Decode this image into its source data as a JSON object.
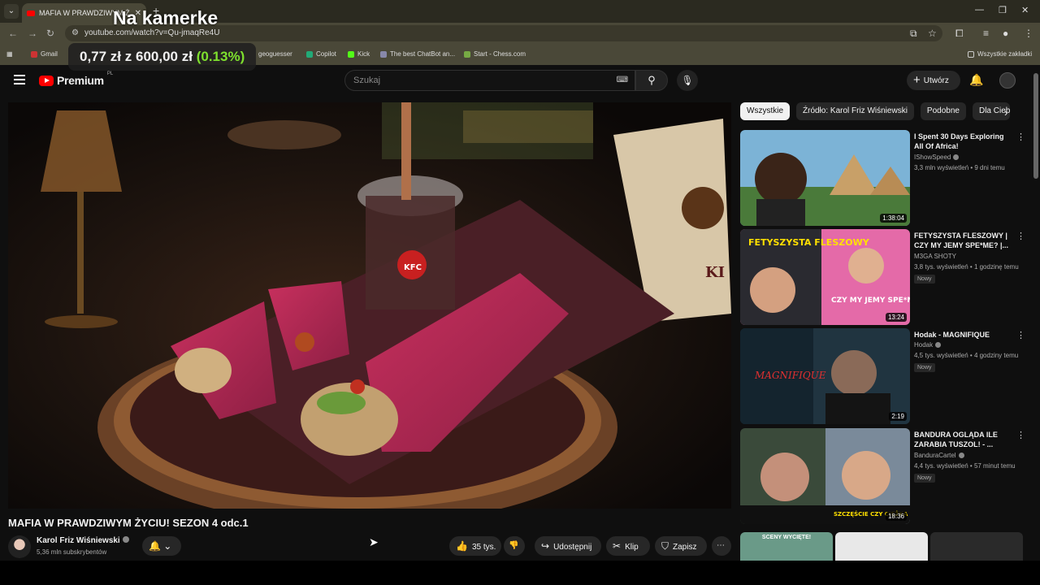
{
  "browser": {
    "tab_title": "MAFIA W PRAWDZIWYM Ż...",
    "url": "youtube.com/watch?v=Qu-jmaqRe4U",
    "bookmarks": [
      "Gmail",
      "geoguesser",
      "Copilot",
      "Kick",
      "The best ChatBot an...",
      "Start - Chess.com"
    ],
    "all_bookmarks": "Wszystkie zakładki"
  },
  "overlay": {
    "title": "Na kamerke",
    "price_current": "0,77 zł",
    "price_sep": "z",
    "price_total": "600,00 zł",
    "price_pct": "(0.13%)"
  },
  "header": {
    "logo": "Premium",
    "region": "PL",
    "search_placeholder": "Szukaj",
    "create_label": "Utwórz"
  },
  "video": {
    "title": "MAFIA W PRAWDZIWYM ŻYCIU! SEZON 4 odc.1",
    "channel": "Karol Friz Wiśniewski",
    "subscribers": "5,36 mln subskrybentów",
    "likes": "35 tys.",
    "share": "Udostępnij",
    "clip": "Klip",
    "save": "Zapisz"
  },
  "chips": [
    "Wszystkie",
    "Źródło: Karol Friz Wiśniewski",
    "Podobne",
    "Dla Ciebie"
  ],
  "recommendations": [
    {
      "title": "I Spent 30 Days Exploring All Of Africa!",
      "channel": "IShowSpeed",
      "meta": "3,3 mln wyświetleń • 9 dni temu",
      "duration": "1:38:04",
      "badge": ""
    },
    {
      "title": "FETYSZYSTA FLESZOWY | CZY MY JEMY SPE*ME? |...",
      "channel": "M3GA SHOTY",
      "meta": "3,8 tys. wyświetleń • 1 godzinę temu",
      "duration": "13:24",
      "badge": "Nowy"
    },
    {
      "title": "Hodak - MAGNIFIQUE",
      "channel": "Hodak",
      "meta": "4,5 tys. wyświetleń • 4 godziny temu",
      "duration": "2:19",
      "badge": "Nowy"
    },
    {
      "title": "BANDURA OGLĄDA ILE ZARABIA TUSZOL! - ...",
      "channel": "BanduraCartel",
      "meta": "4,4 tys. wyświetleń • 57 minut temu",
      "duration": "18:36",
      "badge": "Nowy"
    }
  ],
  "thumb_text": {
    "fetyszysta": "FETYSZYSTA FLESZOWY",
    "czymy": "CZY MY JEMY SPE*ME?",
    "magnifique": "MAGNIFIQUE",
    "szczescie": "SZCZĘŚCIE CZY CIĘŻKA PRACA",
    "sceny": "SCENY WYCIĘTE!"
  }
}
